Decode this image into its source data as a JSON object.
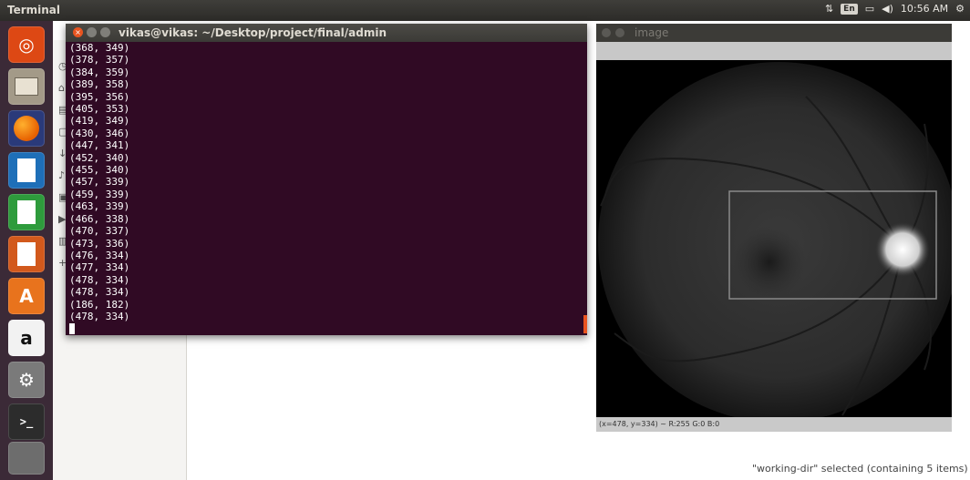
{
  "topbar": {
    "app_title": "Terminal",
    "keyboard_layout": "En",
    "clock": "10:56 AM"
  },
  "launcher": {
    "items": [
      {
        "icon": "ubuntu-dash-icon",
        "color": "#dd4814"
      },
      {
        "icon": "files-icon",
        "color": "#9a8e7a"
      },
      {
        "icon": "firefox-icon",
        "color": "#e66000"
      },
      {
        "icon": "libreoffice-writer-icon",
        "color": "#1e6fb8"
      },
      {
        "icon": "libreoffice-calc-icon",
        "color": "#2e9b3c"
      },
      {
        "icon": "libreoffice-impress-icon",
        "color": "#d2591c"
      },
      {
        "icon": "software-center-icon",
        "color": "#e8731d"
      },
      {
        "icon": "amazon-icon",
        "color": "#ffffff"
      },
      {
        "icon": "system-settings-icon",
        "color": "#8c8c8c"
      },
      {
        "icon": "terminal-icon",
        "color": "#2c2c2c"
      },
      {
        "icon": "trash-icon",
        "color": "#6d6d6d"
      }
    ]
  },
  "terminal": {
    "title": "vikas@vikas: ~/Desktop/project/final/admin",
    "lines": [
      "(368, 349)",
      "(378, 357)",
      "(384, 359)",
      "(389, 358)",
      "(395, 356)",
      "(405, 353)",
      "(419, 349)",
      "(430, 346)",
      "(447, 341)",
      "(452, 340)",
      "(455, 340)",
      "(457, 339)",
      "(459, 339)",
      "(463, 339)",
      "(466, 338)",
      "(470, 337)",
      "(473, 336)",
      "(476, 334)",
      "(477, 334)",
      "(478, 334)",
      "(478, 334)",
      "(186, 182)",
      "(478, 334)"
    ]
  },
  "image_window": {
    "title": "image",
    "status": "(x=478, y=334) ~ R:255 G:0 B:0"
  },
  "filemanager": {
    "status": "\"working-dir\" selected  (containing 5 items)"
  },
  "colors": {
    "terminal_bg": "#300a24",
    "accent": "#e95420",
    "launcher_bg": "#3b2a37"
  }
}
